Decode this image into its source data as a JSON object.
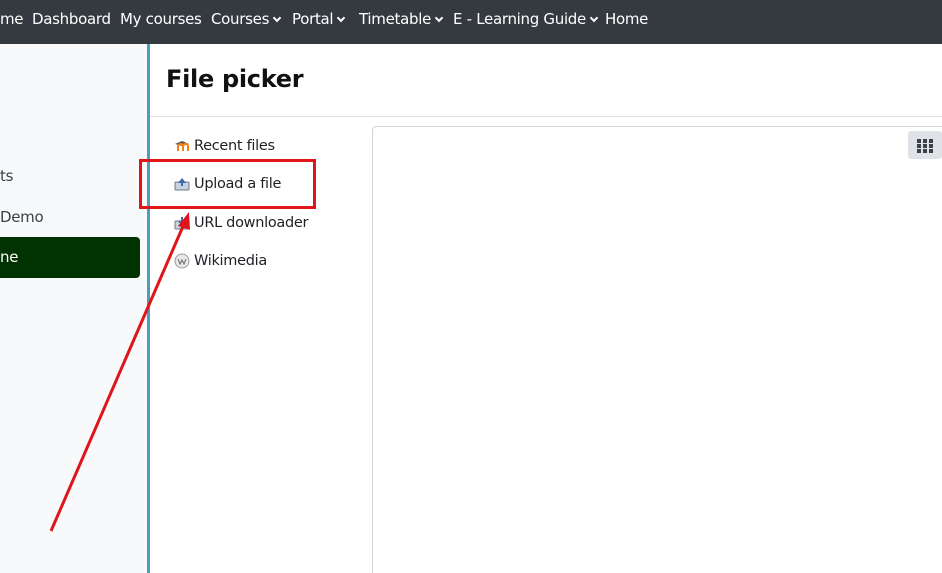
{
  "navbar": {
    "items": [
      {
        "label": "me"
      },
      {
        "label": "Dashboard"
      },
      {
        "label": "My courses"
      },
      {
        "label": "Courses"
      },
      {
        "label": "Portal"
      },
      {
        "label": "Timetable"
      },
      {
        "label": "E - Learning Guide"
      },
      {
        "label": "Home"
      }
    ]
  },
  "drawer": {
    "item1": "ts",
    "item2": "Demo",
    "active": "ne"
  },
  "file_picker": {
    "title": "File picker",
    "repositories": [
      {
        "label": "Recent files",
        "icon": "moodle-icon"
      },
      {
        "label": "Upload a file",
        "icon": "upload-icon"
      },
      {
        "label": "URL downloader",
        "icon": "url-download-icon"
      },
      {
        "label": "Wikimedia",
        "icon": "wikimedia-icon"
      }
    ],
    "view_toggle": {
      "icon": "grid-icon"
    }
  },
  "colors": {
    "navbar": "#343a40",
    "active_drawer": "#013302",
    "highlight": "#e0151a",
    "drawer_border": "#4a9fbe"
  }
}
